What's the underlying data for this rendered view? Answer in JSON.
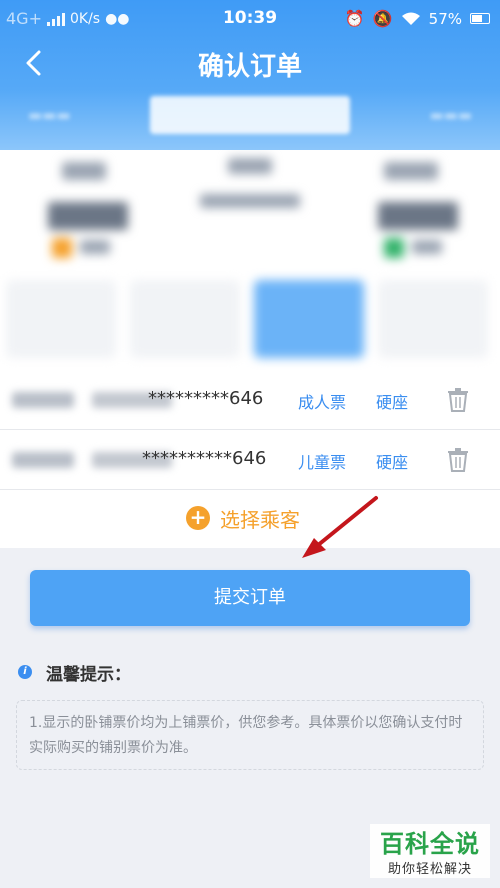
{
  "status_bar": {
    "network": "4G+",
    "speed": "0K/s",
    "time": "10:39",
    "battery": "57%"
  },
  "header": {
    "title": "确认订单"
  },
  "passengers": [
    {
      "id_suffix": "*********646",
      "ticket_type": "成人票",
      "seat_type": "硬座"
    },
    {
      "id_suffix": "**********646",
      "ticket_type": "儿童票",
      "seat_type": "硬座"
    }
  ],
  "add_passenger": {
    "icon": "+",
    "label": "选择乘客"
  },
  "submit": {
    "label": "提交订单"
  },
  "tips": {
    "icon": "i",
    "title": "温馨提示：",
    "text": "1.显示的卧铺票价均为上铺票价，供您参考。具体票价以您确认支付时实际购买的铺别票价为准。"
  },
  "watermark": {
    "brand": "百科全说",
    "slogan": "助你轻松解决"
  },
  "colors": {
    "accent": "#3b8ef0",
    "orange": "#f5a12c",
    "annotation_arrow": "#c4161c"
  }
}
